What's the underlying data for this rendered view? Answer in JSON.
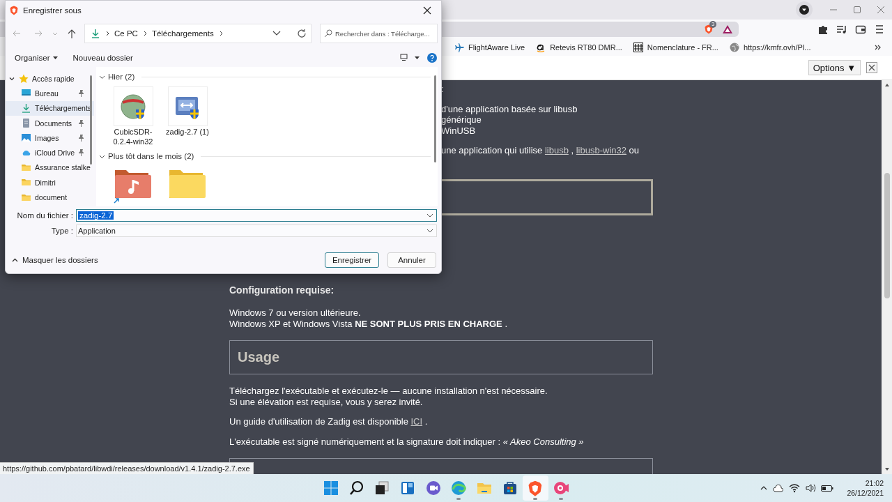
{
  "browser": {
    "shield_badge": "3",
    "bookmarks": [
      {
        "kind": "plane",
        "label": "FlightAware Live"
      },
      {
        "kind": "amazon",
        "label": "Retevis RT80 DMR..."
      },
      {
        "kind": "grid",
        "label": "Nomenclature - FR..."
      },
      {
        "kind": "globe",
        "label": "https://kmfr.ovh/Pl..."
      }
    ],
    "options_label": "Options ▼"
  },
  "page": {
    "blocks": [
      {
        "kind": "partial",
        "lines": [
          [
            {
              "kind": "plain",
              "text": ":"
            }
          ]
        ]
      },
      {
        "kind": "partial",
        "lines": [
          [
            {
              "kind": "plain",
              "text": "d'une application basée sur libusb"
            }
          ],
          [
            {
              "kind": "plain",
              "text": "générique"
            }
          ],
          [
            {
              "kind": "plain",
              "text": "WinUSB"
            }
          ]
        ]
      },
      {
        "kind": "partial",
        "lines": [
          [
            {
              "kind": "plain",
              "text": "une application qui utilise "
            },
            {
              "kind": "link",
              "text": "libusb"
            },
            {
              "kind": "plain",
              "text": " , "
            },
            {
              "kind": "link",
              "text": "libusb-win32"
            },
            {
              "kind": "plain",
              "text": " ou"
            }
          ]
        ]
      },
      {
        "kind": "panel"
      },
      {
        "kind": "heading",
        "text": "Configuration requise:"
      },
      {
        "kind": "paragraph",
        "lines": [
          [
            {
              "kind": "plain",
              "text": "Windows 7 ou version ultérieure."
            }
          ],
          [
            {
              "kind": "plain",
              "text": "Windows XP et Windows Vista "
            },
            {
              "kind": "bold",
              "text": "NE SONT PLUS PRIS EN CHARGE"
            },
            {
              "kind": "plain",
              "text": " ."
            }
          ]
        ]
      },
      {
        "kind": "box",
        "title": "Usage"
      },
      {
        "kind": "paragraph",
        "lines": [
          [
            {
              "kind": "plain",
              "text": "Téléchargez l'exécutable et exécutez-le — aucune installation n'est nécessaire."
            }
          ],
          [
            {
              "kind": "plain",
              "text": "Si une élévation est requise, vous y serez invité."
            }
          ]
        ]
      },
      {
        "kind": "paragraph",
        "lines": [
          [
            {
              "kind": "plain",
              "text": "Un guide d'utilisation de Zadig est disponible "
            },
            {
              "kind": "link",
              "text": "ICI"
            },
            {
              "kind": "plain",
              "text": " ."
            }
          ]
        ]
      },
      {
        "kind": "paragraph",
        "lines": [
          [
            {
              "kind": "plain",
              "text": "L'exécutable est signé numériquement et la signature doit indiquer : "
            },
            {
              "kind": "italic",
              "text": "« Akeo Consulting »"
            }
          ]
        ]
      },
      {
        "kind": "box"
      }
    ],
    "status_url": "https://github.com/pbatard/libwdi/releases/download/v1.4.1/zadig-2.7.exe"
  },
  "dialog": {
    "title": "Enregistrer sous",
    "path": [
      "Ce PC",
      "Téléchargements"
    ],
    "search_placeholder": "Rechercher dans : Télécharge...",
    "commands": [
      {
        "label": "Organiser",
        "menu": true
      },
      {
        "label": "Nouveau dossier",
        "menu": false
      }
    ],
    "nav_tree": [
      {
        "label": "Accès rapide",
        "expanded": true,
        "selected": false,
        "children": [
          {
            "kind": "desktop",
            "label": "Bureau",
            "pinned": true,
            "selected": false
          },
          {
            "kind": "downloads",
            "label": "Téléchargements",
            "pinned": false,
            "selected": true
          },
          {
            "kind": "documents",
            "label": "Documents",
            "pinned": true,
            "selected": false
          },
          {
            "kind": "images",
            "label": "Images",
            "pinned": true,
            "selected": false
          },
          {
            "kind": "cloud",
            "label": "iCloud Drive",
            "pinned": true,
            "selected": false
          },
          {
            "kind": "folder",
            "label": "Assurance stalke",
            "pinned": false,
            "selected": false
          },
          {
            "kind": "folder",
            "label": "Dimitri",
            "pinned": false,
            "selected": false
          },
          {
            "kind": "folder",
            "label": "document",
            "pinned": false,
            "selected": false
          }
        ]
      }
    ],
    "groups": [
      {
        "label": "Hier (2)",
        "expanded": true,
        "items": [
          {
            "kind": "globe",
            "name": "CubicSDR-0.2.4-win32",
            "shortcut": false
          },
          {
            "kind": "usb",
            "name": "zadig-2.7 (1)",
            "shortcut": false
          }
        ]
      },
      {
        "label": "Plus tôt dans le mois (2)",
        "expanded": true,
        "items": [
          {
            "kind": "music",
            "shortcut": true
          },
          {
            "kind": "folder",
            "shortcut": false
          }
        ]
      }
    ],
    "filename_label": "Nom du fichier :",
    "filename": "zadig-2.7",
    "filename_selected": true,
    "type_label": "Type :",
    "type": "Application",
    "toggle_label": "Masquer les dossiers",
    "buttons": [
      {
        "label": "Enregistrer",
        "default": true
      },
      {
        "label": "Annuler",
        "default": false
      }
    ]
  },
  "taskbar": {
    "apps": [
      {
        "kind": "start",
        "running": false,
        "selected": false
      },
      {
        "kind": "search",
        "running": false,
        "selected": false
      },
      {
        "kind": "taskview",
        "running": false,
        "selected": false
      },
      {
        "kind": "widgets",
        "running": false,
        "selected": false
      },
      {
        "kind": "chat",
        "running": false,
        "selected": false
      },
      {
        "kind": "edge",
        "running": true,
        "selected": false
      },
      {
        "kind": "explorer",
        "running": false,
        "selected": false
      },
      {
        "kind": "store",
        "running": false,
        "selected": false
      },
      {
        "kind": "brave",
        "running": true,
        "selected": true
      },
      {
        "kind": "recorder",
        "running": true,
        "selected": false
      }
    ],
    "time": "21:02",
    "date": "26/12/2021"
  }
}
